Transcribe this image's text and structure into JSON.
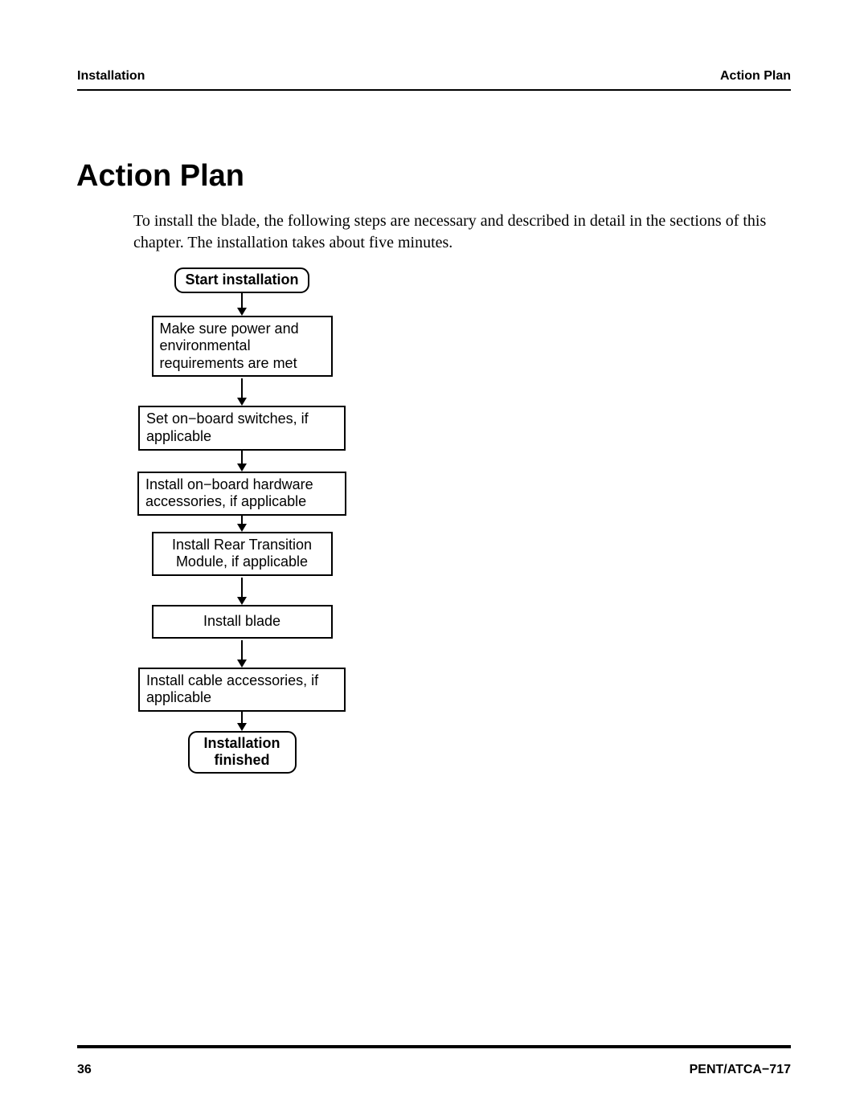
{
  "header": {
    "left": "Installation",
    "right": "Action Plan"
  },
  "heading": "Action Plan",
  "intro": "To install the blade, the following steps are necessary and described in detail in the sections of this chapter. The installation takes about five minutes.",
  "flow": {
    "start": "Start installation",
    "step1": "Make sure power and environmental requirements are met",
    "step2": "Set on−board switches, if applicable",
    "step3": "Install on−board hardware accessories, if applicable",
    "step4": "Install Rear Transition Module, if applicable",
    "step5": "Install blade",
    "step6": "Install cable accessories, if applicable",
    "end": "Installation finished"
  },
  "footer": {
    "page": "36",
    "docid": "PENT/ATCA−717"
  }
}
